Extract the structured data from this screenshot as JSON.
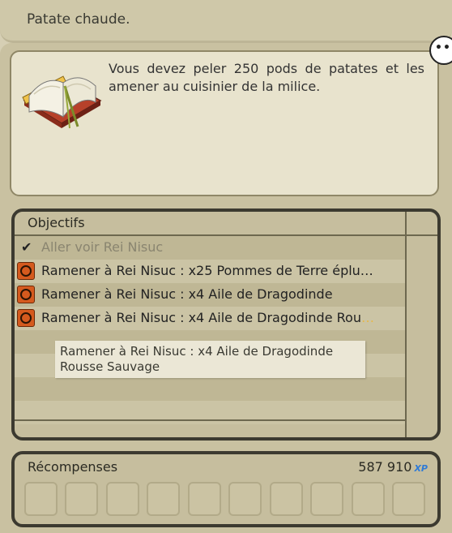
{
  "quest": {
    "title": "Patate chaude.",
    "description": "Vous devez peler 250 pods de patates et les amener au cuisinier de la milice."
  },
  "objectives": {
    "header": "Objectifs",
    "items": [
      {
        "status": "done",
        "text": "Aller voir Rei Nisuc"
      },
      {
        "status": "active",
        "text": "Ramener à Rei Nisuc : x25 Pommes de Terre éplu…"
      },
      {
        "status": "active",
        "text": "Ramener à Rei Nisuc : x4 Aile de Dragodinde"
      },
      {
        "status": "active",
        "text": "Ramener à Rei Nisuc : x4 Aile de Dragodinde Rou",
        "faint_suffix": "…"
      }
    ],
    "tooltip": {
      "line1": "Ramener à Rei Nisuc : x4 Aile de Dragodinde",
      "line2": "Rousse Sauvage"
    }
  },
  "rewards": {
    "header": "Récompenses",
    "xp_value": "587 910",
    "xp_badge": "XP",
    "slot_count": 10
  },
  "icons": {
    "quest_book": "open-book-icon",
    "chat": "speech-bubble-icon",
    "objective_done": "checkmark-icon",
    "objective_active": "compass-target-icon"
  },
  "colors": {
    "accent_orange": "#d55a1e",
    "xp_blue": "#2f7bd6"
  }
}
